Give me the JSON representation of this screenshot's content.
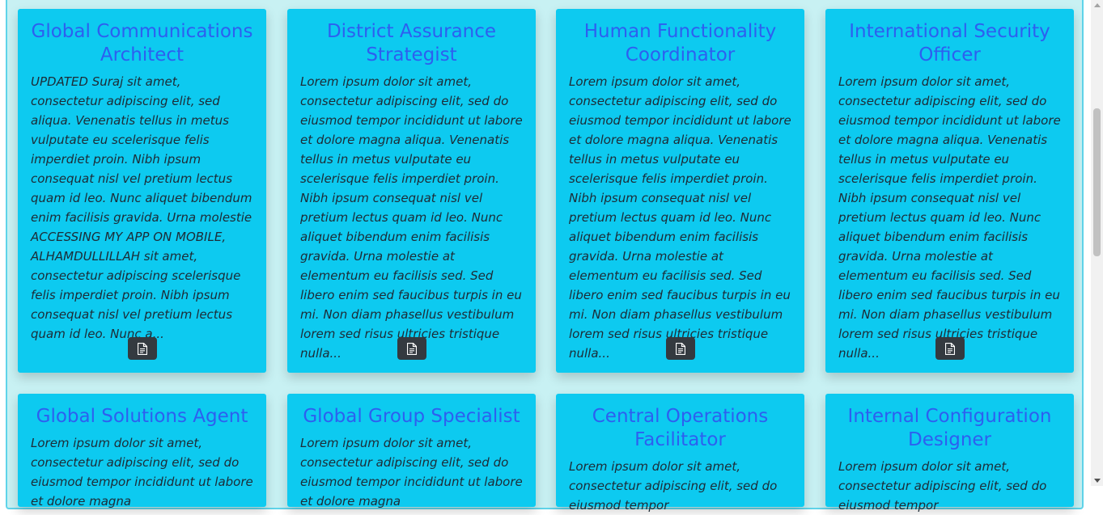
{
  "cards": [
    {
      "title": "Global Communications Architect",
      "text": "UPDATED Suraj sit amet, consectetur adipiscing elit, sed aliqua. Venenatis tellus in metus vulputate eu scelerisque felis imperdiet proin. Nibh ipsum consequat nisl vel pretium lectus quam id leo. Nunc aliquet bibendum enim facilisis gravida. Urna molestie ACCESSING MY APP ON MOBILE, ALHAMDULLILLAH sit amet, consectetur adipiscing scelerisque felis imperdiet proin. Nibh ipsum consequat nisl vel pretium lectus quam id leo. Nunc a..."
    },
    {
      "title": "District Assurance Strategist",
      "text": "Lorem ipsum dolor sit amet, consectetur adipiscing elit, sed do eiusmod tempor incididunt ut labore et dolore magna aliqua. Venenatis tellus in metus vulputate eu scelerisque felis imperdiet proin. Nibh ipsum consequat nisl vel pretium lectus quam id leo. Nunc aliquet bibendum enim facilisis gravida. Urna molestie at elementum eu facilisis sed. Sed libero enim sed faucibus turpis in eu mi. Non diam phasellus vestibulum lorem sed risus ultricies tristique nulla..."
    },
    {
      "title": "Human Functionality Coordinator",
      "text": "Lorem ipsum dolor sit amet, consectetur adipiscing elit, sed do eiusmod tempor incididunt ut labore et dolore magna aliqua. Venenatis tellus in metus vulputate eu scelerisque felis imperdiet proin. Nibh ipsum consequat nisl vel pretium lectus quam id leo. Nunc aliquet bibendum enim facilisis gravida. Urna molestie at elementum eu facilisis sed. Sed libero enim sed faucibus turpis in eu mi. Non diam phasellus vestibulum lorem sed risus ultricies tristique nulla..."
    },
    {
      "title": "International Security Officer",
      "text": "Lorem ipsum dolor sit amet, consectetur adipiscing elit, sed do eiusmod tempor incididunt ut labore et dolore magna aliqua. Venenatis tellus in metus vulputate eu scelerisque felis imperdiet proin. Nibh ipsum consequat nisl vel pretium lectus quam id leo. Nunc aliquet bibendum enim facilisis gravida. Urna molestie at elementum eu facilisis sed. Sed libero enim sed faucibus turpis in eu mi. Non diam phasellus vestibulum lorem sed risus ultricies tristique nulla..."
    },
    {
      "title": "Global Solutions Agent",
      "text": "Lorem ipsum dolor sit amet, consectetur adipiscing elit, sed do eiusmod tempor incididunt ut labore et dolore magna"
    },
    {
      "title": "Global Group Specialist",
      "text": "Lorem ipsum dolor sit amet, consectetur adipiscing elit, sed do eiusmod tempor incididunt ut labore et dolore magna"
    },
    {
      "title": "Central Operations Facilitator",
      "text": "Lorem ipsum dolor sit amet, consectetur adipiscing elit, sed do eiusmod tempor"
    },
    {
      "title": "Internal Configuration Designer",
      "text": "Lorem ipsum dolor sit amet, consectetur adipiscing elit, sed do eiusmod tempor"
    }
  ],
  "icons": {
    "detail_button": "file-text-icon"
  },
  "colors": {
    "card_bg": "#0dcaf0",
    "title": "#2d5ff0",
    "button": "#343a40",
    "page_bg": "#c8f1f3"
  }
}
